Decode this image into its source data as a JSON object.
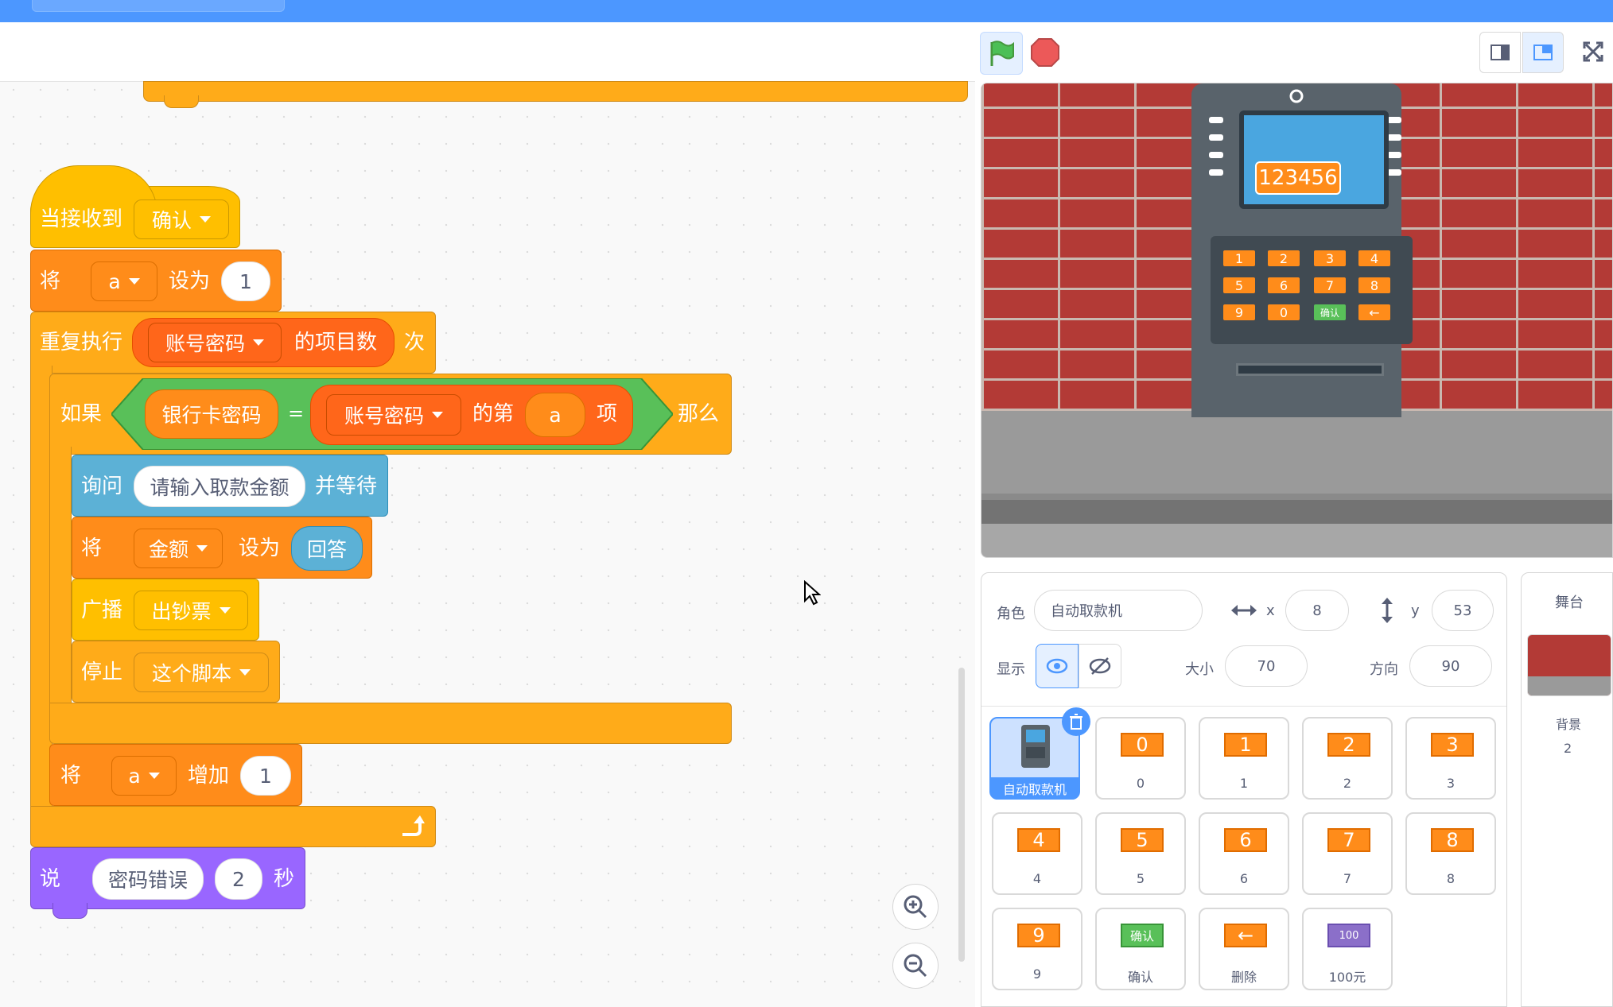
{
  "colors": {
    "accent": "#4c97ff",
    "events": "#ffbf00",
    "control": "#ffab19",
    "variables": "#ff8c1a",
    "sensing": "#5cb1d6",
    "operators": "#59c059",
    "lists": "#ff661a",
    "looks": "#9966ff"
  },
  "script": {
    "hat": {
      "label": "当接收到",
      "message": "确认"
    },
    "set_a": {
      "label": "将",
      "var": "a",
      "mid": "设为",
      "value": "1"
    },
    "repeat": {
      "label": "重复执行",
      "list": "账号密码",
      "suffix": "的项目数",
      "tail": "次"
    },
    "if": {
      "label": "如果",
      "left": "银行卡密码",
      "op": "=",
      "list": "账号密码",
      "item_prefix": "的第",
      "index": "a",
      "item_suffix": "项",
      "then": "那么"
    },
    "ask": {
      "label": "询问",
      "question": "请输入取款金额",
      "tail": "并等待"
    },
    "set_amount": {
      "label": "将",
      "var": "金额",
      "mid": "设为",
      "value": "回答"
    },
    "broadcast": {
      "label": "广播",
      "message": "出钞票"
    },
    "stop": {
      "label": "停止",
      "option": "这个脚本"
    },
    "change_a": {
      "label": "将",
      "var": "a",
      "mid": "增加",
      "value": "1"
    },
    "say": {
      "label": "说",
      "text": "密码错误",
      "secs": "2",
      "tail": "秒"
    }
  },
  "stage": {
    "atm_display": "123456",
    "keys": [
      "1",
      "2",
      "3",
      "4",
      "5",
      "6",
      "7",
      "8",
      "9",
      "0",
      "确认",
      "←"
    ]
  },
  "sprite_info": {
    "sprite_label": "角色",
    "sprite_name": "自动取款机",
    "x_label": "x",
    "x_value": "8",
    "y_label": "y",
    "y_value": "53",
    "show_label": "显示",
    "size_label": "大小",
    "size_value": "70",
    "direction_label": "方向",
    "direction_value": "90"
  },
  "sprites": [
    {
      "name": "自动取款机",
      "thumb": "",
      "selected": true
    },
    {
      "name": "0",
      "thumb": "0"
    },
    {
      "name": "1",
      "thumb": "1"
    },
    {
      "name": "2",
      "thumb": "2"
    },
    {
      "name": "3",
      "thumb": "3"
    },
    {
      "name": "4",
      "thumb": "4"
    },
    {
      "name": "5",
      "thumb": "5"
    },
    {
      "name": "6",
      "thumb": "6"
    },
    {
      "name": "7",
      "thumb": "7"
    },
    {
      "name": "8",
      "thumb": "8"
    },
    {
      "name": "9",
      "thumb": "9"
    },
    {
      "name": "确认",
      "thumb": "确认"
    },
    {
      "name": "删除",
      "thumb": "←"
    },
    {
      "name": "100元",
      "thumb": "100"
    }
  ],
  "stage_panel": {
    "title": "舞台",
    "backdrop_label": "背景",
    "backdrop_count": "2"
  }
}
